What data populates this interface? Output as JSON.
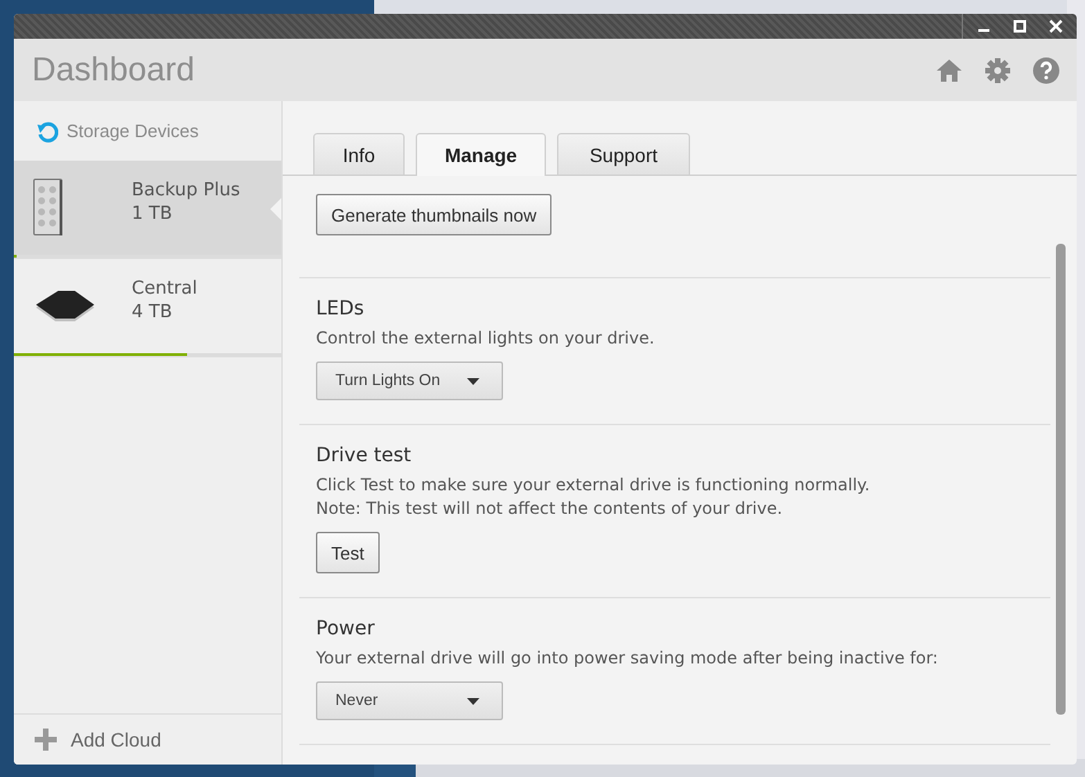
{
  "window": {
    "title": "Dashboard"
  },
  "sidebar": {
    "header": "Storage Devices",
    "devices": [
      {
        "name": "Backup Plus",
        "capacity": "1 TB",
        "kind": "portable",
        "selected": true,
        "level": 0.01
      },
      {
        "name": "Central",
        "capacity": "4 TB",
        "kind": "desktop",
        "selected": false,
        "level": 0.65
      }
    ],
    "footer": "Add Cloud"
  },
  "tabs": [
    {
      "label": "Info",
      "selected": false
    },
    {
      "label": "Manage",
      "selected": true
    },
    {
      "label": "Support",
      "selected": false
    }
  ],
  "sections": [
    {
      "control": {
        "kind": "button",
        "label": "Generate thumbnails now"
      }
    },
    {
      "title": "LEDs",
      "lines": [
        "Control the external lights on your drive."
      ],
      "control": {
        "kind": "dropdown",
        "label": "Turn Lights On"
      }
    },
    {
      "title": "Drive test",
      "lines": [
        "Click Test to make sure your external drive is functioning normally.",
        "Note: This test will not affect the contents of your drive."
      ],
      "control": {
        "kind": "button",
        "label": "Test"
      }
    },
    {
      "title": "Power",
      "lines": [
        "Your external drive will go into power saving mode after being inactive for:"
      ],
      "control": {
        "kind": "dropdown",
        "label": "Never"
      }
    }
  ]
}
